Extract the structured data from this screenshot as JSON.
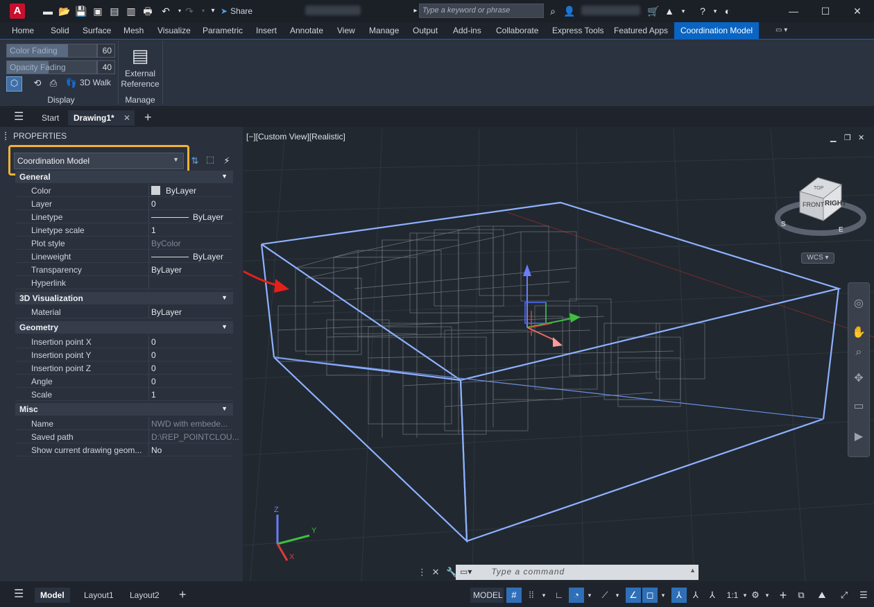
{
  "titlebar": {
    "app_letter": "A",
    "share_label": "Share",
    "search_placeholder": "Type a keyword or phrase"
  },
  "ribbon_tabs": [
    "Home",
    "Solid",
    "Surface",
    "Mesh",
    "Visualize",
    "Parametric",
    "Insert",
    "Annotate",
    "View",
    "Manage",
    "Output",
    "Add-ins",
    "Collaborate",
    "Express Tools",
    "Featured Apps",
    "Coordination Model"
  ],
  "ribbon": {
    "color_fading_label": "Color Fading",
    "color_fading_value": "60",
    "opacity_fading_label": "Opacity Fading",
    "opacity_fading_value": "40",
    "walk_label": "3D Walk",
    "display_label": "Display",
    "xref_line1": "External",
    "xref_line2": "Reference",
    "manage_label": "Manage"
  },
  "doc_tabs": {
    "start": "Start",
    "drawing": "Drawing1*"
  },
  "properties": {
    "title": "PROPERTIES",
    "selector": "Coordination Model",
    "general_header": "General",
    "viz_header": "3D Visualization",
    "geometry_header": "Geometry",
    "misc_header": "Misc",
    "general": [
      {
        "k": "Color",
        "v": "ByLayer"
      },
      {
        "k": "Layer",
        "v": "0"
      },
      {
        "k": "Linetype",
        "v": "ByLayer"
      },
      {
        "k": "Linetype scale",
        "v": "1"
      },
      {
        "k": "Plot style",
        "v": "ByColor"
      },
      {
        "k": "Lineweight",
        "v": "ByLayer"
      },
      {
        "k": "Transparency",
        "v": "ByLayer"
      },
      {
        "k": "Hyperlink",
        "v": ""
      }
    ],
    "viz": [
      {
        "k": "Material",
        "v": "ByLayer"
      }
    ],
    "geometry": [
      {
        "k": "Insertion point X",
        "v": "0"
      },
      {
        "k": "Insertion point Y",
        "v": "0"
      },
      {
        "k": "Insertion point Z",
        "v": "0"
      },
      {
        "k": "Angle",
        "v": "0"
      },
      {
        "k": "Scale",
        "v": "1"
      }
    ],
    "misc": [
      {
        "k": "Name",
        "v": "NWD with embede..."
      },
      {
        "k": "Saved path",
        "v": "D:\\REP_POINTCLOU..."
      },
      {
        "k": "Show current drawing geom...",
        "v": "No"
      }
    ]
  },
  "viewport": {
    "label": "[−][Custom View][Realistic]",
    "viewcube_front": "FRONT",
    "viewcube_right": "RIGHT",
    "viewcube_top": "TOP",
    "compass_s": "S",
    "compass_e": "E",
    "wcs": "WCS",
    "ucs_x": "X",
    "ucs_y": "Y",
    "ucs_z": "Z"
  },
  "command": {
    "placeholder": "Type a command"
  },
  "statusbar": {
    "model_tab": "Model",
    "layout1": "Layout1",
    "layout2": "Layout2",
    "model_btn": "MODEL",
    "scale": "1:1"
  },
  "colors": {
    "accent": "#0a64c2",
    "highlight": "#f2b233",
    "arrow": "#e3201b",
    "bbox": "#7fa8ff"
  }
}
